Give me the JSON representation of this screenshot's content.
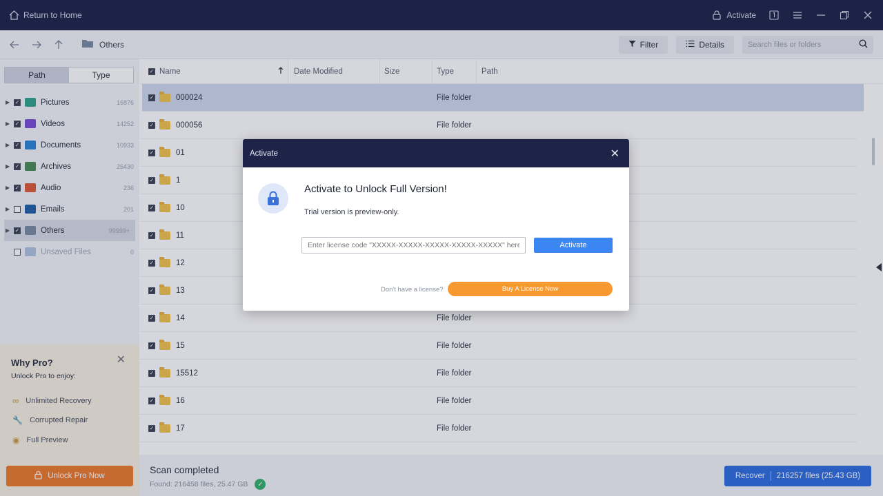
{
  "titlebar": {
    "home_label": "Return to Home",
    "activate_label": "Activate"
  },
  "toolbar": {
    "crumb": "Others",
    "filter_label": "Filter",
    "details_label": "Details",
    "search_placeholder": "Search files or folders"
  },
  "sidebar": {
    "tabs": [
      "Path",
      "Type"
    ],
    "items": [
      {
        "label": "Pictures",
        "count": "16876",
        "color": "#2fa58c"
      },
      {
        "label": "Videos",
        "count": "14252",
        "color": "#7a4ed8"
      },
      {
        "label": "Documents",
        "count": "10933",
        "color": "#2d86d6"
      },
      {
        "label": "Archives",
        "count": "26430",
        "color": "#4d8a5a"
      },
      {
        "label": "Audio",
        "count": "236",
        "color": "#e0593a"
      },
      {
        "label": "Emails",
        "count": "201",
        "color": "#1f5fa8"
      },
      {
        "label": "Others",
        "count": "99999+",
        "color": "#7c8aa4"
      },
      {
        "label": "Unsaved Files",
        "count": "0",
        "color": "#b0c4e0"
      }
    ]
  },
  "whypro": {
    "title": "Why Pro?",
    "subtitle": "Unlock Pro to enjoy:",
    "features": [
      "Unlimited Recovery",
      "Corrupted Repair",
      "Full Preview"
    ],
    "unlock_label": "Unlock Pro Now"
  },
  "list": {
    "columns": [
      "Name",
      "Date Modified",
      "Size",
      "Type",
      "Path"
    ],
    "rows": [
      {
        "name": "000024",
        "type": "File folder"
      },
      {
        "name": "000056",
        "type": "File folder"
      },
      {
        "name": "01",
        "type": ""
      },
      {
        "name": "1",
        "type": ""
      },
      {
        "name": "10",
        "type": ""
      },
      {
        "name": "11",
        "type": ""
      },
      {
        "name": "12",
        "type": ""
      },
      {
        "name": "13",
        "type": ""
      },
      {
        "name": "14",
        "type": "File folder"
      },
      {
        "name": "15",
        "type": "File folder"
      },
      {
        "name": "15512",
        "type": "File folder"
      },
      {
        "name": "16",
        "type": "File folder"
      },
      {
        "name": "17",
        "type": "File folder"
      }
    ]
  },
  "bottom": {
    "status": "Scan completed",
    "found": "Found: 216458 files, 25.47 GB",
    "recover_label": "Recover",
    "recover_count": "216257 files (25.43 GB)"
  },
  "modal": {
    "title": "Activate",
    "heading": "Activate to Unlock Full Version!",
    "trial_text": "Trial version is preview-only.",
    "license_placeholder": "Enter license code \"XXXXX-XXXXX-XXXXX-XXXXX-XXXXX\" here.",
    "activate_label": "Activate",
    "no_license": "Don't have a license?",
    "buy_label": "Buy A License Now"
  }
}
